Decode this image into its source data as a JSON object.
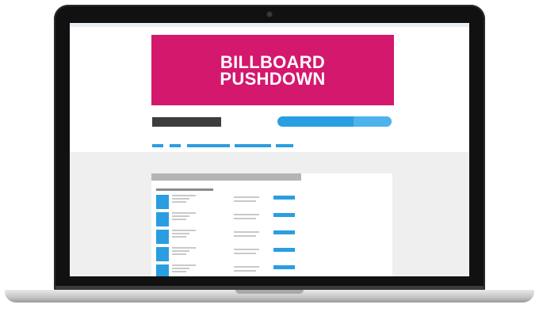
{
  "billboard": {
    "line1": "BILLBOARD",
    "line2": "PUSHDOWN",
    "color": "#d4186e"
  },
  "colors": {
    "accent": "#2a9ee0",
    "bezel": "#111111",
    "placeholder_dark": "#3d3d3d",
    "placeholder_light": "#c9c9c9",
    "content_bg": "#efefef"
  },
  "nav": {
    "item_count": 5
  },
  "list": {
    "row_count": 5
  },
  "icons": {
    "camera": "webcam-dot"
  }
}
